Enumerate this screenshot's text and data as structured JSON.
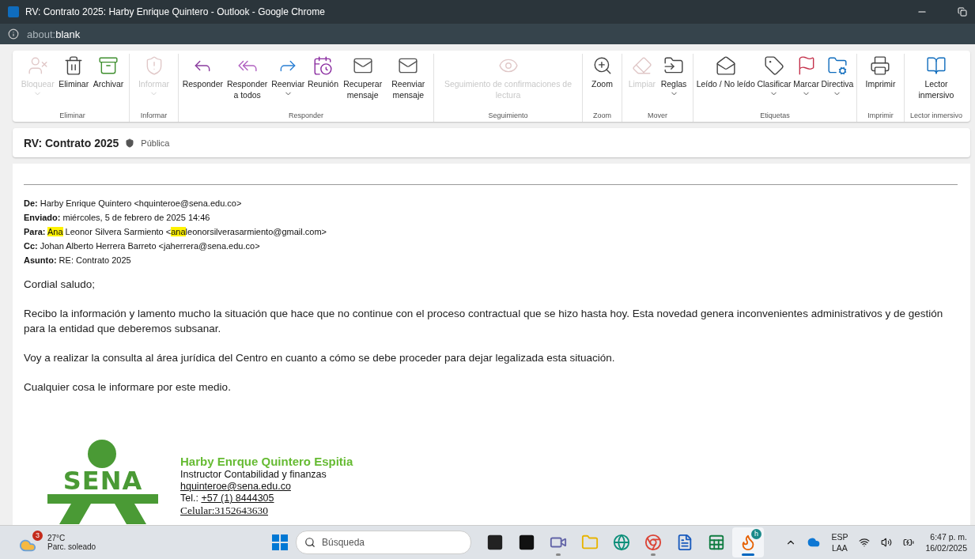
{
  "window": {
    "title": "RV: Contrato 2025: Harby Enrique Quintero - Outlook - Google Chrome",
    "address_prefix": "about:",
    "address_host": "blank"
  },
  "ribbon": {
    "groups": [
      {
        "label": "Eliminar",
        "buttons": [
          {
            "label": "Bloquear",
            "disabled": true,
            "has_menu": true
          },
          {
            "label": "Eliminar",
            "disabled": false,
            "has_menu": false
          },
          {
            "label": "Archivar",
            "disabled": false,
            "has_menu": false
          }
        ]
      },
      {
        "label": "Informar",
        "buttons": [
          {
            "label": "Informar",
            "disabled": true,
            "has_menu": true
          }
        ]
      },
      {
        "label": "Responder",
        "buttons": [
          {
            "label": "Responder",
            "disabled": false,
            "has_menu": false
          },
          {
            "label": "Responder a todos",
            "disabled": false,
            "has_menu": false
          },
          {
            "label": "Reenviar",
            "disabled": false,
            "has_menu": true
          },
          {
            "label": "Reunión",
            "disabled": false,
            "has_menu": false
          },
          {
            "label": "Recuperar mensaje",
            "disabled": false,
            "has_menu": false
          },
          {
            "label": "Reenviar mensaje",
            "disabled": false,
            "has_menu": false
          }
        ]
      },
      {
        "label": "Seguimiento",
        "buttons": [
          {
            "label": "Seguimiento de confirmaciones de lectura",
            "disabled": true,
            "has_menu": false
          }
        ]
      },
      {
        "label": "Zoom",
        "buttons": [
          {
            "label": "Zoom",
            "disabled": false,
            "has_menu": false
          }
        ]
      },
      {
        "label": "Mover",
        "buttons": [
          {
            "label": "Limpiar",
            "disabled": true,
            "has_menu": false
          },
          {
            "label": "Reglas",
            "disabled": false,
            "has_menu": true
          }
        ]
      },
      {
        "label": "Etiquetas",
        "buttons": [
          {
            "label": "Leído / No leído",
            "disabled": false,
            "has_menu": false
          },
          {
            "label": "Clasificar",
            "disabled": false,
            "has_menu": true
          },
          {
            "label": "Marcar",
            "disabled": false,
            "has_menu": true
          },
          {
            "label": "Directiva",
            "disabled": false,
            "has_menu": true
          }
        ]
      },
      {
        "label": "Imprimir",
        "buttons": [
          {
            "label": "Imprimir",
            "disabled": false,
            "has_menu": false
          }
        ]
      },
      {
        "label": "Lector inmersivo",
        "buttons": [
          {
            "label": "Lector inmersivo",
            "disabled": false,
            "has_menu": false
          }
        ]
      }
    ]
  },
  "message": {
    "subject": "RV: Contrato 2025",
    "sensitivity": "Pública",
    "headers": [
      {
        "label": "De:",
        "segments": [
          {
            "text": "Harby Enrique Quintero <hquinteroe@sena.edu.co>",
            "highlighted": false
          }
        ]
      },
      {
        "label": "Enviado:",
        "segments": [
          {
            "text": "miércoles, 5 de febrero de 2025 14:46",
            "highlighted": false
          }
        ]
      },
      {
        "label": "Para:",
        "segments": [
          {
            "text": "Ana",
            "highlighted": true
          },
          {
            "text": " Leonor Silvera Sarmiento <",
            "highlighted": false
          },
          {
            "text": "ana",
            "highlighted": true
          },
          {
            "text": "leonorsilverasarmiento@gmail.com>",
            "highlighted": false
          }
        ]
      },
      {
        "label": "Cc:",
        "segments": [
          {
            "text": "Johan Alberto Herrera Barreto <jaherrera@sena.edu.co>",
            "highlighted": false
          }
        ]
      },
      {
        "label": "Asunto:",
        "segments": [
          {
            "text": "RE: Contrato 2025",
            "highlighted": false
          }
        ]
      }
    ],
    "paragraphs": [
      "Cordial saludo;",
      "Recibo la información y lamento mucho la situación que hace que no continue con el proceso contractual que se hizo hasta hoy. Esta novedad genera inconvenientes administrativos y de gestión para la entidad que deberemos subsanar.",
      "Voy a realizar la consulta al área jurídica del Centro en cuanto a cómo se debe proceder para dejar legalizada esta situación.",
      "Cualquier cosa le informare por este medio."
    ],
    "signature": {
      "logo_text": "SENA",
      "name": "Harby Enrque Quintero Espitia",
      "role": "Instructor Contabilidad y finanzas",
      "email": "hquinteroe@sena.edu.co",
      "phone_label": "Tel.:",
      "phone": "+57 (1) 8444305",
      "mobile": "Celular:3152643630"
    }
  },
  "taskbar": {
    "weather": {
      "badge": "3",
      "temperature": "27°C",
      "condition": "Parc. soleado"
    },
    "search": {
      "placeholder": "Búsqueda"
    },
    "apps": [
      {
        "open": false,
        "selected": false
      },
      {
        "open": false,
        "selected": false
      },
      {
        "open": true,
        "selected": false
      },
      {
        "open": false,
        "selected": false
      },
      {
        "open": false,
        "selected": false
      },
      {
        "open": true,
        "selected": false
      },
      {
        "open": false,
        "selected": false
      },
      {
        "open": false,
        "selected": false
      },
      {
        "open": true,
        "selected": true
      }
    ],
    "profile_badge": "h",
    "language": "ESP",
    "layout": "LAA",
    "time": "6:47 p. m.",
    "date": "16/02/2025"
  }
}
